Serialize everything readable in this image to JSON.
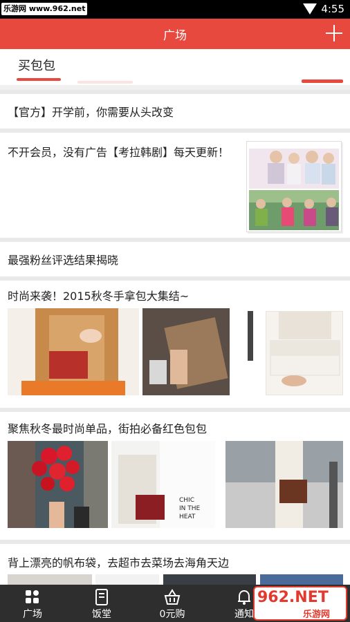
{
  "status_bar": {
    "watermark": "乐游网 www.962.net",
    "time": "4:55"
  },
  "app_bar": {
    "title": "广场",
    "add_icon": "plus-icon"
  },
  "tabs": {
    "active": "买包包"
  },
  "feed": [
    {
      "title": "【官方】开学前，你需要从头改变"
    },
    {
      "title": "不开会员，没有广告【考拉韩剧】每天更新！"
    },
    {
      "title": "最强粉丝评选结果揭晓"
    },
    {
      "title": "时尚来袭！2015秋冬手拿包大集结~"
    },
    {
      "title": "聚焦秋冬最时尚单品，街拍必备红色包包",
      "image_text": "CHIC IN THE HEAT"
    },
    {
      "title": "背上漂亮的帆布袋，去超市去菜场去海角天边"
    }
  ],
  "bottom_nav": [
    {
      "label": "广场",
      "icon": "grid-icon"
    },
    {
      "label": "饭堂",
      "icon": "book-icon"
    },
    {
      "label": "0元购",
      "icon": "basket-icon"
    },
    {
      "label": "通知",
      "icon": "bell-icon"
    }
  ],
  "watermark_logo": {
    "main": "962.NET",
    "sub": "乐游网"
  },
  "colors": {
    "accent": "#e8493f",
    "nav_bg": "#2e2e2e"
  }
}
